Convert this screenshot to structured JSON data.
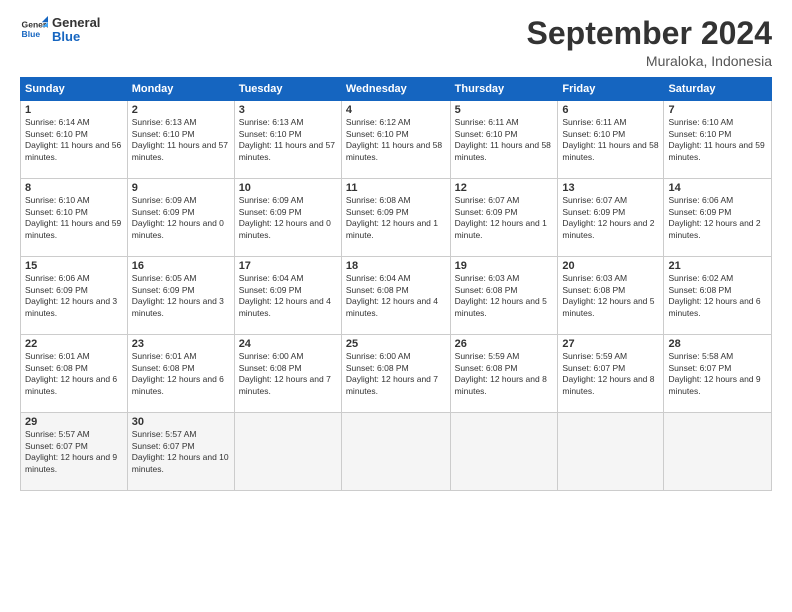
{
  "logo": {
    "line1": "General",
    "line2": "Blue"
  },
  "title": "September 2024",
  "location": "Muraloka, Indonesia",
  "weekdays": [
    "Sunday",
    "Monday",
    "Tuesday",
    "Wednesday",
    "Thursday",
    "Friday",
    "Saturday"
  ],
  "weeks": [
    [
      {
        "day": "1",
        "sunrise": "6:14 AM",
        "sunset": "6:10 PM",
        "daylight": "11 hours and 56 minutes."
      },
      {
        "day": "2",
        "sunrise": "6:13 AM",
        "sunset": "6:10 PM",
        "daylight": "11 hours and 57 minutes."
      },
      {
        "day": "3",
        "sunrise": "6:13 AM",
        "sunset": "6:10 PM",
        "daylight": "11 hours and 57 minutes."
      },
      {
        "day": "4",
        "sunrise": "6:12 AM",
        "sunset": "6:10 PM",
        "daylight": "11 hours and 58 minutes."
      },
      {
        "day": "5",
        "sunrise": "6:11 AM",
        "sunset": "6:10 PM",
        "daylight": "11 hours and 58 minutes."
      },
      {
        "day": "6",
        "sunrise": "6:11 AM",
        "sunset": "6:10 PM",
        "daylight": "11 hours and 58 minutes."
      },
      {
        "day": "7",
        "sunrise": "6:10 AM",
        "sunset": "6:10 PM",
        "daylight": "11 hours and 59 minutes."
      }
    ],
    [
      {
        "day": "8",
        "sunrise": "6:10 AM",
        "sunset": "6:10 PM",
        "daylight": "11 hours and 59 minutes."
      },
      {
        "day": "9",
        "sunrise": "6:09 AM",
        "sunset": "6:09 PM",
        "daylight": "12 hours and 0 minutes."
      },
      {
        "day": "10",
        "sunrise": "6:09 AM",
        "sunset": "6:09 PM",
        "daylight": "12 hours and 0 minutes."
      },
      {
        "day": "11",
        "sunrise": "6:08 AM",
        "sunset": "6:09 PM",
        "daylight": "12 hours and 1 minute."
      },
      {
        "day": "12",
        "sunrise": "6:07 AM",
        "sunset": "6:09 PM",
        "daylight": "12 hours and 1 minute."
      },
      {
        "day": "13",
        "sunrise": "6:07 AM",
        "sunset": "6:09 PM",
        "daylight": "12 hours and 2 minutes."
      },
      {
        "day": "14",
        "sunrise": "6:06 AM",
        "sunset": "6:09 PM",
        "daylight": "12 hours and 2 minutes."
      }
    ],
    [
      {
        "day": "15",
        "sunrise": "6:06 AM",
        "sunset": "6:09 PM",
        "daylight": "12 hours and 3 minutes."
      },
      {
        "day": "16",
        "sunrise": "6:05 AM",
        "sunset": "6:09 PM",
        "daylight": "12 hours and 3 minutes."
      },
      {
        "day": "17",
        "sunrise": "6:04 AM",
        "sunset": "6:09 PM",
        "daylight": "12 hours and 4 minutes."
      },
      {
        "day": "18",
        "sunrise": "6:04 AM",
        "sunset": "6:08 PM",
        "daylight": "12 hours and 4 minutes."
      },
      {
        "day": "19",
        "sunrise": "6:03 AM",
        "sunset": "6:08 PM",
        "daylight": "12 hours and 5 minutes."
      },
      {
        "day": "20",
        "sunrise": "6:03 AM",
        "sunset": "6:08 PM",
        "daylight": "12 hours and 5 minutes."
      },
      {
        "day": "21",
        "sunrise": "6:02 AM",
        "sunset": "6:08 PM",
        "daylight": "12 hours and 6 minutes."
      }
    ],
    [
      {
        "day": "22",
        "sunrise": "6:01 AM",
        "sunset": "6:08 PM",
        "daylight": "12 hours and 6 minutes."
      },
      {
        "day": "23",
        "sunrise": "6:01 AM",
        "sunset": "6:08 PM",
        "daylight": "12 hours and 6 minutes."
      },
      {
        "day": "24",
        "sunrise": "6:00 AM",
        "sunset": "6:08 PM",
        "daylight": "12 hours and 7 minutes."
      },
      {
        "day": "25",
        "sunrise": "6:00 AM",
        "sunset": "6:08 PM",
        "daylight": "12 hours and 7 minutes."
      },
      {
        "day": "26",
        "sunrise": "5:59 AM",
        "sunset": "6:08 PM",
        "daylight": "12 hours and 8 minutes."
      },
      {
        "day": "27",
        "sunrise": "5:59 AM",
        "sunset": "6:07 PM",
        "daylight": "12 hours and 8 minutes."
      },
      {
        "day": "28",
        "sunrise": "5:58 AM",
        "sunset": "6:07 PM",
        "daylight": "12 hours and 9 minutes."
      }
    ],
    [
      {
        "day": "29",
        "sunrise": "5:57 AM",
        "sunset": "6:07 PM",
        "daylight": "12 hours and 9 minutes."
      },
      {
        "day": "30",
        "sunrise": "5:57 AM",
        "sunset": "6:07 PM",
        "daylight": "12 hours and 10 minutes."
      },
      null,
      null,
      null,
      null,
      null
    ]
  ],
  "labels": {
    "sunrise_prefix": "Sunrise: ",
    "sunset_prefix": "Sunset: ",
    "daylight_prefix": "Daylight: "
  }
}
